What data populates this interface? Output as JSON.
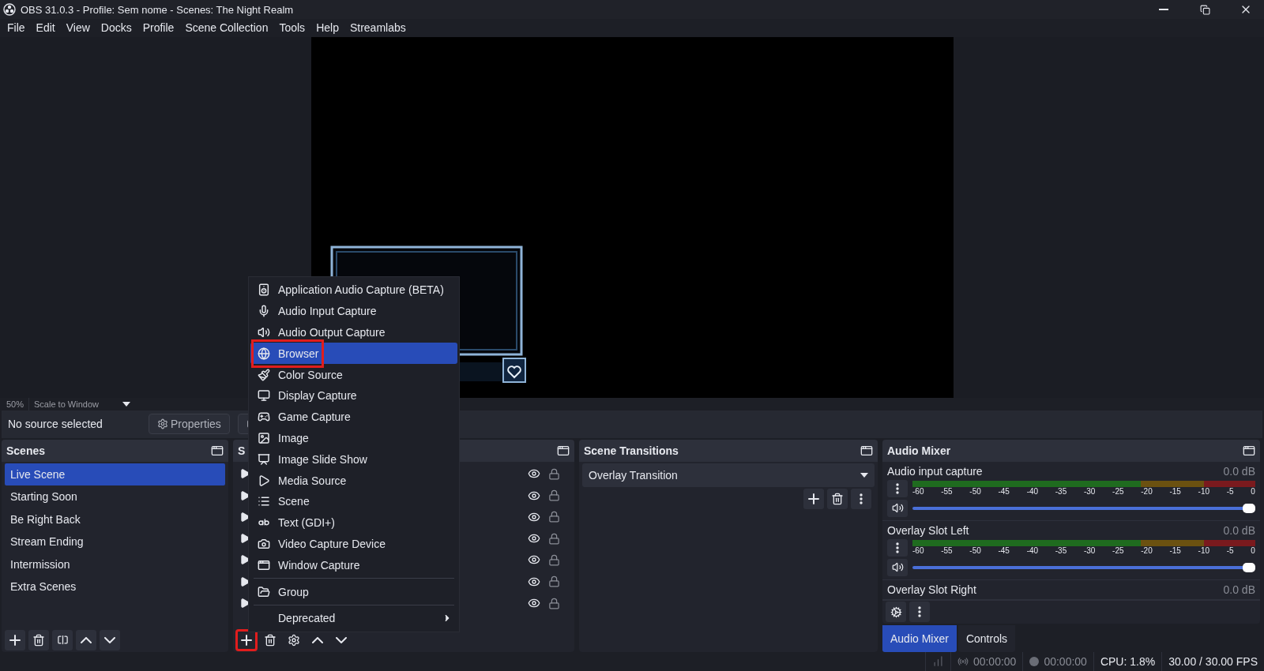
{
  "window": {
    "title": "OBS 31.0.3 - Profile: Sem nome - Scenes: The Night Realm"
  },
  "menu_bar": [
    "File",
    "Edit",
    "View",
    "Docks",
    "Profile",
    "Scene Collection",
    "Tools",
    "Help",
    "Streamlabs"
  ],
  "preview": {
    "zoom": "50%",
    "scale_mode": "Scale to Window"
  },
  "context_bar": {
    "status": "No source selected",
    "properties_button": "Properties"
  },
  "scenes": {
    "title": "Scenes",
    "items": [
      {
        "label": "Live Scene",
        "selected": true
      },
      {
        "label": "Starting Soon",
        "selected": false
      },
      {
        "label": "Be Right Back",
        "selected": false
      },
      {
        "label": "Stream Ending",
        "selected": false
      },
      {
        "label": "Intermission",
        "selected": false
      },
      {
        "label": "Extra Scenes",
        "selected": false
      }
    ]
  },
  "sources": {
    "title": "S",
    "add_button_annotated": true,
    "rows": [
      {
        "visible": true
      },
      {
        "visible": true
      },
      {
        "visible": true
      },
      {
        "visible": true
      },
      {
        "visible": true
      },
      {
        "visible": true
      },
      {
        "visible": true
      }
    ]
  },
  "add_source_menu": {
    "sections": [
      [
        {
          "label": "Application Audio Capture (BETA)",
          "selected": false,
          "annotated": false,
          "submenu": false
        },
        {
          "label": "Audio Input Capture",
          "selected": false,
          "annotated": false,
          "submenu": false
        },
        {
          "label": "Audio Output Capture",
          "selected": false,
          "annotated": false,
          "submenu": false
        },
        {
          "label": "Browser",
          "selected": true,
          "annotated": true,
          "submenu": false
        },
        {
          "label": "Color Source",
          "selected": false,
          "annotated": false,
          "submenu": false
        },
        {
          "label": "Display Capture",
          "selected": false,
          "annotated": false,
          "submenu": false
        },
        {
          "label": "Game Capture",
          "selected": false,
          "annotated": false,
          "submenu": false
        },
        {
          "label": "Image",
          "selected": false,
          "annotated": false,
          "submenu": false
        },
        {
          "label": "Image Slide Show",
          "selected": false,
          "annotated": false,
          "submenu": false
        },
        {
          "label": "Media Source",
          "selected": false,
          "annotated": false,
          "submenu": false
        },
        {
          "label": "Scene",
          "selected": false,
          "annotated": false,
          "submenu": false
        },
        {
          "label": "Text (GDI+)",
          "selected": false,
          "annotated": false,
          "submenu": false
        },
        {
          "label": "Video Capture Device",
          "selected": false,
          "annotated": false,
          "submenu": false
        },
        {
          "label": "Window Capture",
          "selected": false,
          "annotated": false,
          "submenu": false
        }
      ],
      [
        {
          "label": "Group",
          "selected": false,
          "annotated": false,
          "submenu": false
        }
      ],
      [
        {
          "label": "Deprecated",
          "selected": false,
          "annotated": false,
          "submenu": true
        }
      ]
    ]
  },
  "scene_transitions": {
    "title": "Scene Transitions",
    "transition": "Overlay Transition"
  },
  "audio_mixer": {
    "title": "Audio Mixer",
    "channels": [
      {
        "name": "Audio input capture",
        "reading": "0.0 dB",
        "level": 1,
        "ticks": [
          "-60",
          "-55",
          "-50",
          "-45",
          "-40",
          "-35",
          "-30",
          "-25",
          "-20",
          "-15",
          "-10",
          "-5",
          "0"
        ]
      },
      {
        "name": "Overlay Slot Left",
        "reading": "0.0 dB",
        "level": 1,
        "ticks": [
          "-60",
          "-55",
          "-50",
          "-45",
          "-40",
          "-35",
          "-30",
          "-25",
          "-20",
          "-15",
          "-10",
          "-5",
          "0"
        ]
      },
      {
        "name": "Overlay Slot Right",
        "reading": "0.0 dB"
      }
    ]
  },
  "dock_tabs": [
    {
      "label": "Audio Mixer",
      "selected": true
    },
    {
      "label": "Controls",
      "selected": false
    }
  ],
  "status_bar": {
    "stream_time": "00:00:00",
    "record_time": "00:00:00",
    "cpu": "CPU: 1.8%",
    "fps": "30.00 / 30.00 FPS"
  }
}
